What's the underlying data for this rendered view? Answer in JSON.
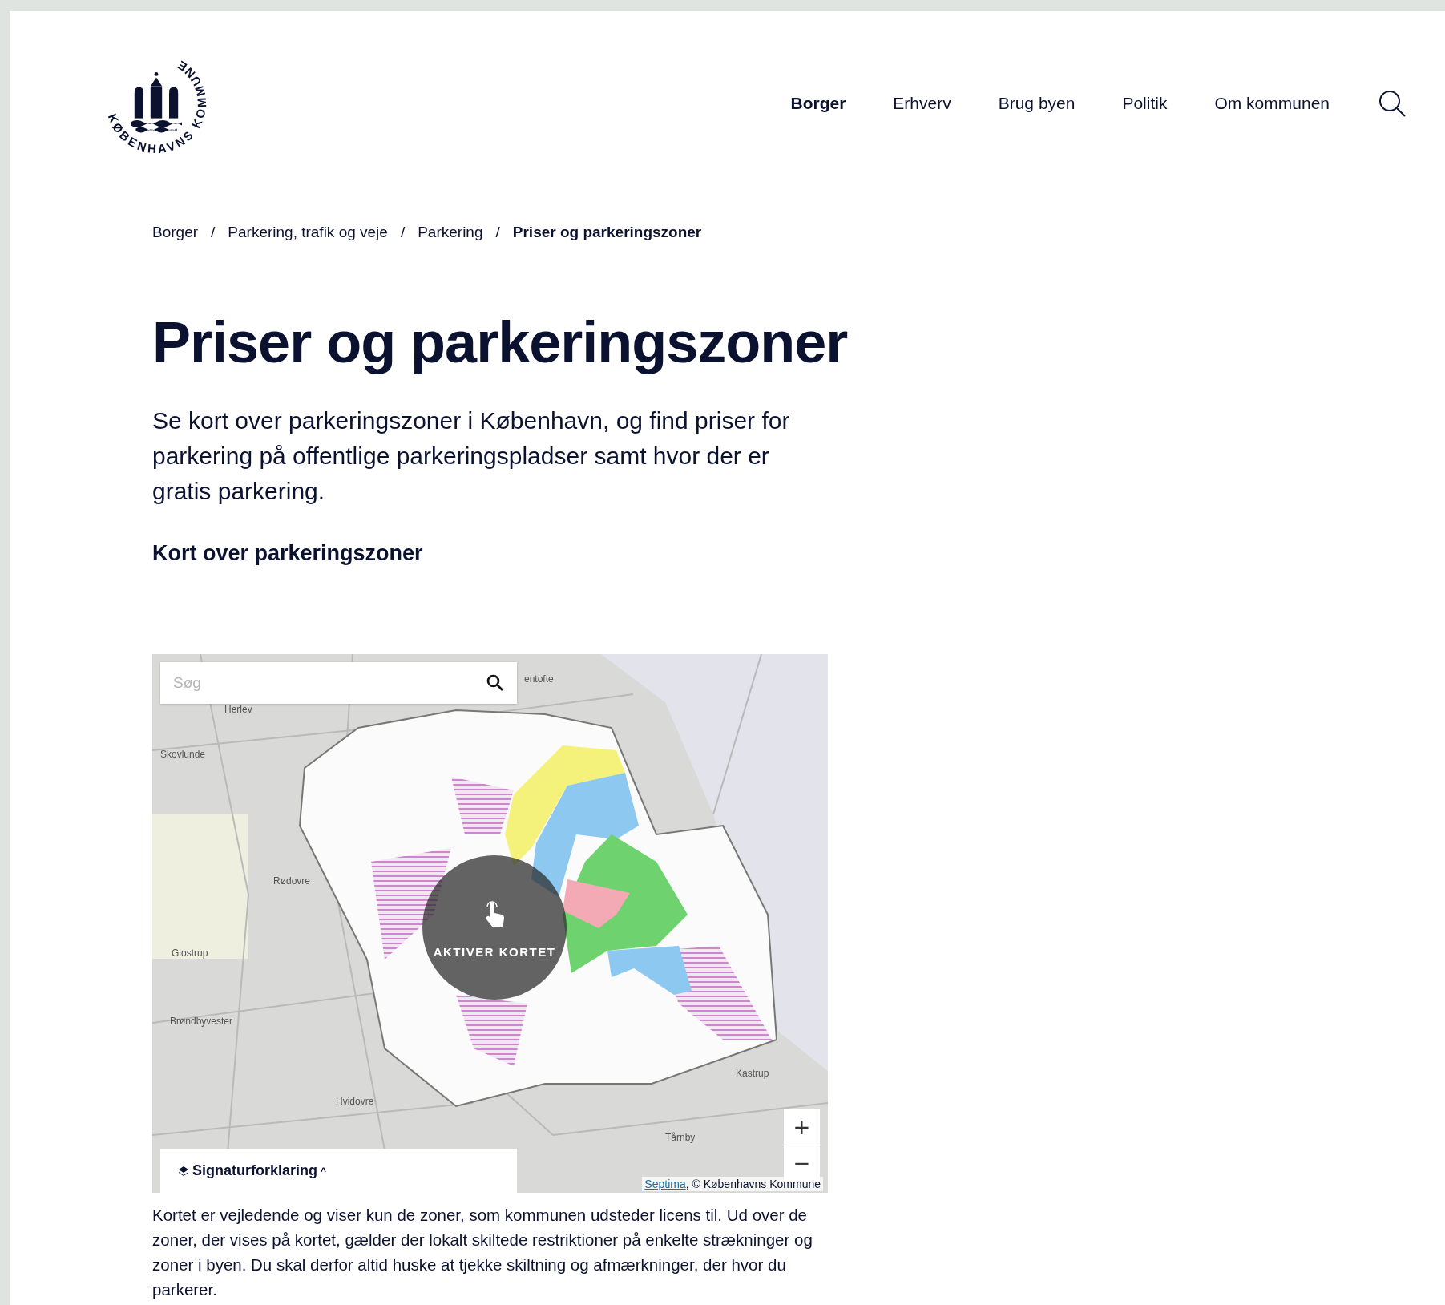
{
  "logo": {
    "ring_text": "KØBENHAVNS KOMMUNE"
  },
  "nav": [
    {
      "label": "Borger",
      "selected": true
    },
    {
      "label": "Erhverv",
      "selected": false
    },
    {
      "label": "Brug byen",
      "selected": false
    },
    {
      "label": "Politik",
      "selected": false
    },
    {
      "label": "Om kommunen",
      "selected": false
    }
  ],
  "breadcrumb": [
    {
      "label": "Borger",
      "current": false
    },
    {
      "label": "Parkering, trafik og veje",
      "current": false
    },
    {
      "label": "Parkering",
      "current": false
    },
    {
      "label": "Priser og parkeringszoner",
      "current": true
    }
  ],
  "breadcrumb_separator": "/",
  "title": "Priser og parkeringszoner",
  "intro": "Se kort over parkeringszoner i København, og find priser for parkering på offentlige parkeringspladser samt hvor der er gratis parkering.",
  "section_heading": "Kort over parkeringszoner",
  "map": {
    "search": {
      "placeholder": "Søg"
    },
    "place_labels": [
      "entofte",
      "Herlev",
      "Skovlunde",
      "Rødovre",
      "Glostrup",
      "Brøndbyvester",
      "Hvidovre",
      "Kastrup",
      "Tårnby"
    ],
    "activate_label": "AKTIVER KORTET",
    "legend_toggle": {
      "label": "Signaturforklaring",
      "expanded": false,
      "caret": "^"
    },
    "zoom_in": "+",
    "zoom_out": "−",
    "attribution_link": "Septima",
    "attribution_text": ", © Københavns Kommune"
  },
  "caption": "Kortet er vejledende og viser kun de zoner, som kommunen udsteder licens til. Ud over de zoner, der vises på kortet, gælder der lokalt skiltede restriktioner på enkelte strækninger og zoner i byen. Du skal derfor altid huske at tjekke skiltning og afmærkninger, der hvor du parkerer."
}
